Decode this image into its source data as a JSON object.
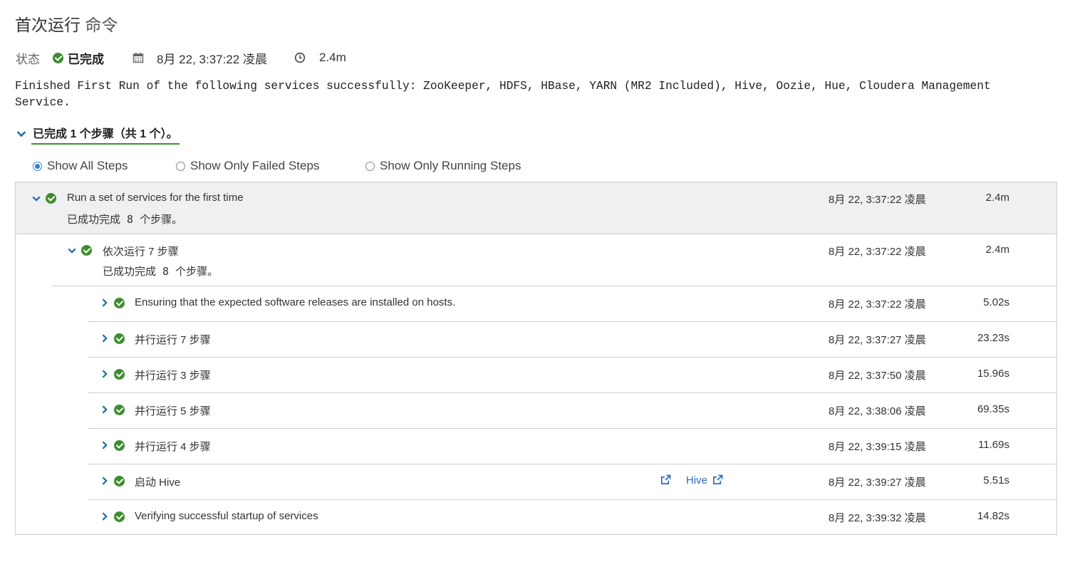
{
  "header": {
    "title_main": "首次运行",
    "title_sub": "命令"
  },
  "status": {
    "label": "状态",
    "value": "已完成",
    "date": "8月 22, 3:37:22 凌晨",
    "duration": "2.4m",
    "colors": {
      "success": "#3e8d2f"
    }
  },
  "message": "Finished First Run of the following services successfully: ZooKeeper, HDFS, HBase, YARN (MR2 Included), Hive, Oozie, Hue, Cloudera Management\nService.",
  "summary": "已完成 1 个步骤（共 1 个）。",
  "filters": {
    "options": [
      "Show All Steps",
      "Show Only Failed Steps",
      "Show Only Running Steps"
    ],
    "selected": "Show All Steps"
  },
  "steps": {
    "top": {
      "name": "Run a set of services for the first time",
      "desc": "已成功完成 8 个步骤。",
      "date": "8月 22, 3:37:22 凌晨",
      "duration": "2.4m"
    },
    "group": {
      "name": "依次运行 7 步骤",
      "desc": "已成功完成 8 个步骤。",
      "date": "8月 22, 3:37:22 凌晨",
      "duration": "2.4m"
    },
    "children": [
      {
        "name": "Ensuring that the expected software releases are installed on hosts.",
        "date": "8月 22, 3:37:22 凌晨",
        "duration": "5.02s"
      },
      {
        "name": "并行运行 7 步骤",
        "date": "8月 22, 3:37:27 凌晨",
        "duration": "23.23s"
      },
      {
        "name": "并行运行 3 步骤",
        "date": "8月 22, 3:37:50 凌晨",
        "duration": "15.96s"
      },
      {
        "name": "并行运行 5 步骤",
        "date": "8月 22, 3:38:06 凌晨",
        "duration": "69.35s"
      },
      {
        "name": "并行运行 4 步骤",
        "date": "8月 22, 3:39:15 凌晨",
        "duration": "11.69s"
      },
      {
        "name": "启动 Hive",
        "date": "8月 22, 3:39:27 凌晨",
        "duration": "5.51s",
        "link": "Hive"
      },
      {
        "name": "Verifying successful startup of services",
        "date": "8月 22, 3:39:32 凌晨",
        "duration": "14.82s"
      }
    ]
  },
  "icons": {
    "calendar": "calendar-icon",
    "clock": "clock-icon",
    "expand": "chevron-down-icon",
    "collapsed": "chevron-right-icon",
    "success": "check-circle-icon",
    "external": "external-link-icon"
  }
}
